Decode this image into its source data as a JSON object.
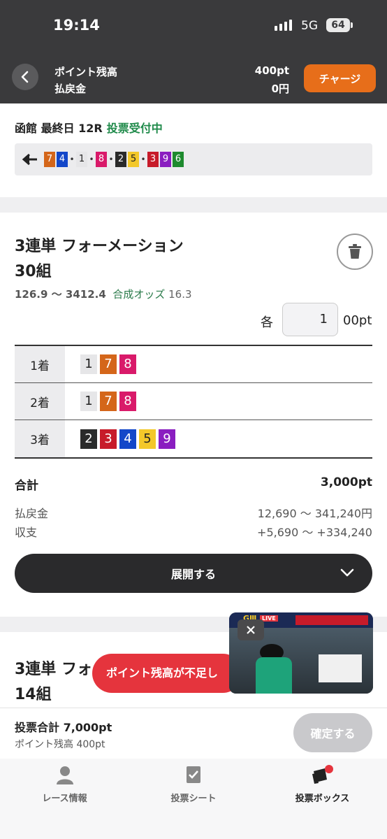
{
  "status_bar": {
    "time": "19:14",
    "network": "5G",
    "battery": "64"
  },
  "header": {
    "points_label": "ポイント残高",
    "points_value": "400pt",
    "refund_label": "払戻金",
    "refund_value": "0円",
    "charge_label": "チャージ"
  },
  "race": {
    "title": "函館 最終日 12R",
    "status": "投票受付中",
    "recent": [
      {
        "n": "7",
        "bg": "#d4661a",
        "fg": "#fff"
      },
      {
        "n": "4",
        "bg": "#1347c9",
        "fg": "#fff"
      },
      {
        "sep": "•"
      },
      {
        "n": "1",
        "bg": "#e6e6e8",
        "fg": "#222"
      },
      {
        "sep": "•"
      },
      {
        "n": "8",
        "bg": "#d91a6a",
        "fg": "#fff"
      },
      {
        "sep": "•"
      },
      {
        "n": "2",
        "bg": "#2a2a2a",
        "fg": "#fff"
      },
      {
        "n": "5",
        "bg": "#f3c82a",
        "fg": "#222"
      },
      {
        "sep": "•"
      },
      {
        "n": "3",
        "bg": "#c71b2a",
        "fg": "#fff"
      },
      {
        "n": "9",
        "bg": "#8a1ec0",
        "fg": "#fff"
      },
      {
        "n": "6",
        "bg": "#1e8a2e",
        "fg": "#fff"
      }
    ]
  },
  "bet1": {
    "type": "3連単 フォーメーション",
    "count": "30組",
    "odds_range": "126.9 〜 3412.4",
    "combined_label": "合成オッズ",
    "combined_value": "16.3",
    "each_label": "各",
    "unit_value": "1",
    "unit_suffix": "00pt",
    "rows": [
      {
        "label": "1着",
        "nums": [
          {
            "n": "1",
            "bg": "#e6e6e8",
            "fg": "#222"
          },
          {
            "n": "7",
            "bg": "#d4661a",
            "fg": "#fff"
          },
          {
            "n": "8",
            "bg": "#d91a6a",
            "fg": "#fff"
          }
        ]
      },
      {
        "label": "2着",
        "nums": [
          {
            "n": "1",
            "bg": "#e6e6e8",
            "fg": "#222"
          },
          {
            "n": "7",
            "bg": "#d4661a",
            "fg": "#fff"
          },
          {
            "n": "8",
            "bg": "#d91a6a",
            "fg": "#fff"
          }
        ]
      },
      {
        "label": "3着",
        "nums": [
          {
            "n": "2",
            "bg": "#2a2a2a",
            "fg": "#fff"
          },
          {
            "n": "3",
            "bg": "#c71b2a",
            "fg": "#fff"
          },
          {
            "n": "4",
            "bg": "#1347c9",
            "fg": "#fff"
          },
          {
            "n": "5",
            "bg": "#f3c82a",
            "fg": "#222"
          },
          {
            "n": "9",
            "bg": "#8a1ec0",
            "fg": "#fff"
          }
        ]
      }
    ],
    "total_label": "合計",
    "total_value": "3,000pt",
    "payout_label": "払戻金",
    "payout_value": "12,690 〜 341,240円",
    "balance_label": "収支",
    "balance_value": "+5,690 〜 +334,240",
    "expand_label": "展開する"
  },
  "bet2": {
    "type": "3連単 フォ",
    "count": "14組"
  },
  "toast": "ポイント残高が不足し",
  "video": {
    "badge": "LIVE",
    "grade": "GⅢ"
  },
  "footer": {
    "total": "投票合計 7,000pt",
    "balance": "ポイント残高 400pt",
    "confirm_label": "確定する"
  },
  "nav": [
    {
      "label": "レース情報",
      "icon": "person-icon"
    },
    {
      "label": "投票シート",
      "icon": "sheet-icon"
    },
    {
      "label": "投票ボックス",
      "icon": "ticket-box-icon"
    }
  ]
}
